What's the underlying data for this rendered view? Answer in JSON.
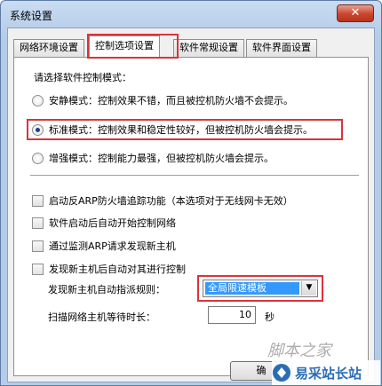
{
  "window": {
    "title": "系统设置",
    "close_label": "✕"
  },
  "tabs": [
    {
      "label": "网络环境设置",
      "active": false
    },
    {
      "label": "控制选项设置",
      "active": true
    },
    {
      "label": "软件常规设置",
      "active": false
    },
    {
      "label": "软件界面设置",
      "active": false
    }
  ],
  "mode": {
    "prompt": "请选择软件控制模式：",
    "options": [
      {
        "label": "安静模式：控制效果不错，而且被控机防火墙不会提示。",
        "checked": false
      },
      {
        "label": "标准模式：控制效果和稳定性较好，但被控机防火墙会提示。",
        "checked": true
      },
      {
        "label": "增强模式：控制能力最强，但被控机防火墙会提示。",
        "checked": false
      }
    ]
  },
  "checkboxes": [
    {
      "label": "启动反ARP防火墙追踪功能（本选项对于无线网卡无效）",
      "checked": false
    },
    {
      "label": "软件启动后自动开始控制网络",
      "checked": false
    },
    {
      "label": "通过监测ARP请求发现新主机",
      "checked": false
    },
    {
      "label": "发现新主机后自动对其进行控制",
      "checked": false
    }
  ],
  "auto_rule": {
    "label": "发现新主机自动指派规则：",
    "selected": "全局限速模板"
  },
  "scan_wait": {
    "label": "扫描网络主机等待时长：",
    "value": "10",
    "unit": "秒"
  },
  "buttons": {
    "ok_label": "确"
  },
  "watermark": {
    "script": "脚本之家",
    "site": "易采站长站"
  },
  "colors": {
    "highlight": "#d8343a",
    "selection": "#3399ff",
    "close": "#c8462f"
  }
}
